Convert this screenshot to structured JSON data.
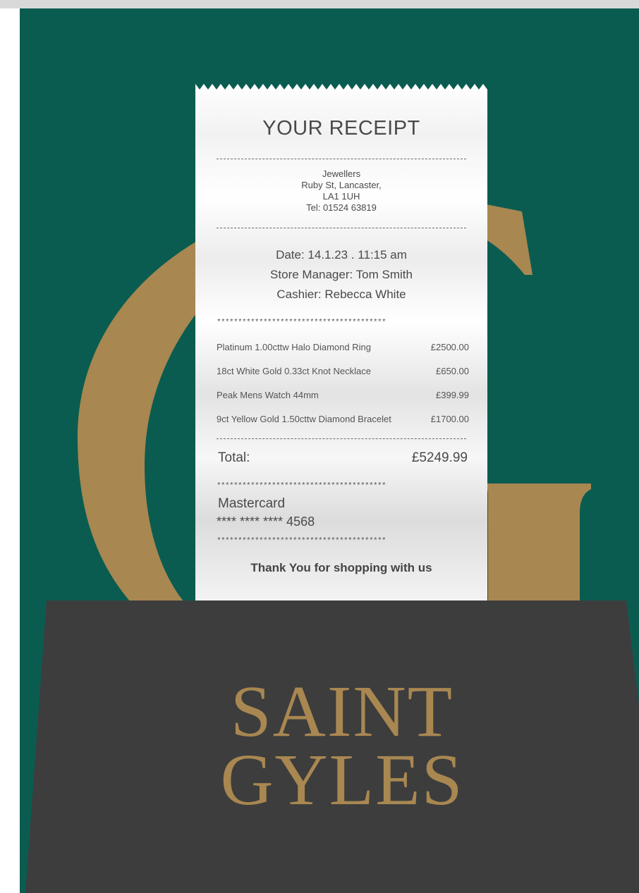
{
  "colors": {
    "background_green": "#0b5c50",
    "gold": "#a88751",
    "bag_charcoal": "#3d3d3d",
    "receipt_text": "#4a4a4a"
  },
  "receipt": {
    "title": "YOUR RECEIPT",
    "store": {
      "name": "Jewellers",
      "street": "Ruby St, Lancaster,",
      "postcode": "LA1 1UH",
      "tel": "Tel: 01524 63819"
    },
    "date": "Date: 14.1.23 . 11:15 am",
    "store_manager": "Store Manager: Tom Smith",
    "cashier": "Cashier: Rebecca White",
    "stars": "****************************************",
    "items": [
      {
        "name": "Platinum 1.00cttw Halo Diamond Ring",
        "price": "£2500.00"
      },
      {
        "name": "18ct White Gold 0.33ct Knot Necklace",
        "price": "£650.00"
      },
      {
        "name": "Peak Mens Watch 44mm",
        "price": "£399.99"
      },
      {
        "name": "9ct Yellow Gold 1.50cttw Diamond Bracelet",
        "price": "£1700.00"
      }
    ],
    "total_label": "Total:",
    "total_value": "£5249.99",
    "card_name": "Mastercard",
    "card_number": "**** **** **** 4568",
    "thanks": "Thank You for shopping with us"
  },
  "brand": {
    "line1": "SAINT",
    "line2": "GYLES"
  },
  "icons": {
    "letter_g": "large-gold-g-logo",
    "bag": "charcoal-shopping-bag"
  }
}
